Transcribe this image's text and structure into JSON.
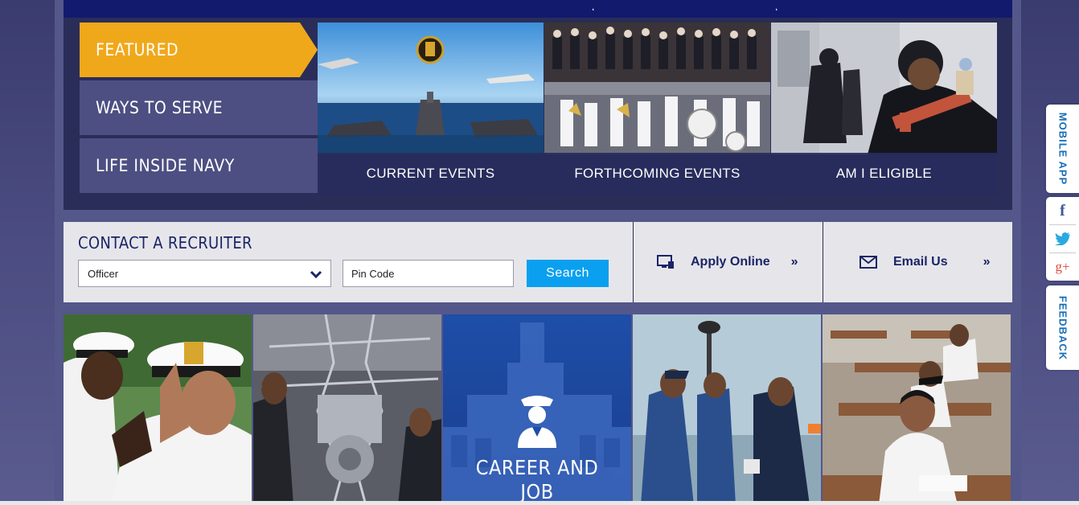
{
  "menu": {
    "items": [
      {
        "label": "FEATURED",
        "active": true
      },
      {
        "label": "WAYS TO SERVE",
        "active": false
      },
      {
        "label": "LIFE INSIDE NAVY",
        "active": false
      }
    ]
  },
  "tiles": [
    {
      "caption": "CURRENT EVENTS"
    },
    {
      "caption": "FORTHCOMING EVENTS"
    },
    {
      "caption": "AM I ELIGIBLE"
    }
  ],
  "contact": {
    "title": "CONTACT A RECRUITER",
    "select_value": "Officer",
    "pin_placeholder": "Pin Code",
    "search_label": "Search",
    "apply_label": "Apply Online",
    "email_label": "Email Us",
    "more_glyph": "»"
  },
  "bottom": {
    "career_line1": "CAREER AND",
    "career_line2": "JOB"
  },
  "side": {
    "mobile_app": "MOBILE APP",
    "feedback": "FEEDBACK",
    "facebook_glyph": "f",
    "google_glyph": "g+"
  },
  "colors": {
    "accent": "#f0a81b",
    "navy": "#1b2466",
    "search_blue": "#0aa0ef",
    "menu_bg": "#4d4f82"
  }
}
